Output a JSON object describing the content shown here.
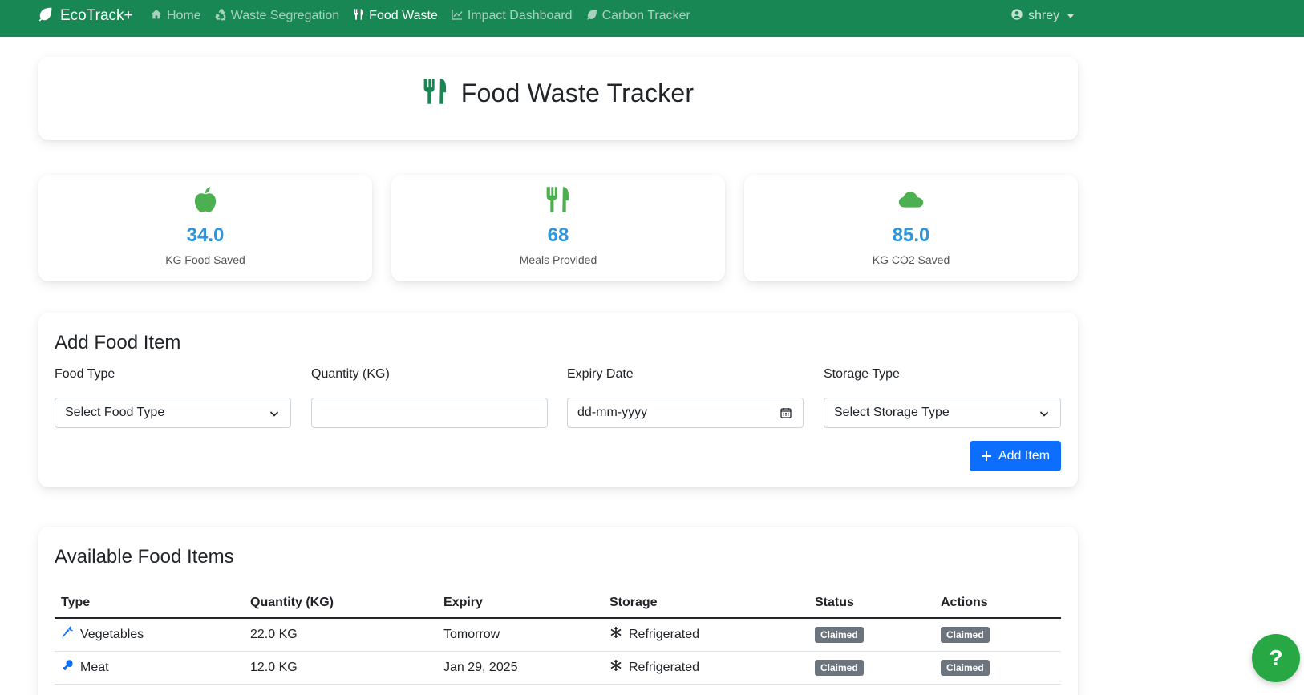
{
  "nav": {
    "brand": "EcoTrack+",
    "links": [
      {
        "label": "Home",
        "icon": "home-icon"
      },
      {
        "label": "Waste Segregation",
        "icon": "recycle-icon"
      },
      {
        "label": "Food Waste",
        "icon": "utensils-icon",
        "active": true
      },
      {
        "label": "Impact Dashboard",
        "icon": "line-chart-icon"
      },
      {
        "label": "Carbon Tracker",
        "icon": "leaf-icon"
      }
    ],
    "user": "shrey"
  },
  "header": {
    "title": "Food Waste Tracker"
  },
  "stats": [
    {
      "value": "34.0",
      "label": "KG Food Saved",
      "icon": "apple-icon"
    },
    {
      "value": "68",
      "label": "Meals Provided",
      "icon": "utensils-icon"
    },
    {
      "value": "85.0",
      "label": "KG CO2 Saved",
      "icon": "cloud-icon"
    }
  ],
  "add_form": {
    "title": "Add Food Item",
    "food_type": {
      "label": "Food Type",
      "value": "Select Food Type"
    },
    "quantity": {
      "label": "Quantity (KG)",
      "value": ""
    },
    "expiry": {
      "label": "Expiry Date",
      "value": "dd-mm-yyyy"
    },
    "storage": {
      "label": "Storage Type",
      "value": "Select Storage Type"
    },
    "submit_label": "Add Item"
  },
  "items": {
    "title": "Available Food Items",
    "columns": [
      "Type",
      "Quantity (KG)",
      "Expiry",
      "Storage",
      "Status",
      "Actions"
    ],
    "rows": [
      {
        "type": "Vegetables",
        "type_icon": "carrot-icon",
        "quantity": "22.0 KG",
        "expiry": "Tomorrow",
        "storage": "Refrigerated",
        "storage_icon": "snowflake-icon",
        "status": "Claimed",
        "action": "Claimed"
      },
      {
        "type": "Meat",
        "type_icon": "drumstick-icon",
        "quantity": "12.0 KG",
        "expiry": "Jan 29, 2025",
        "storage": "Refrigerated",
        "storage_icon": "snowflake-icon",
        "status": "Claimed",
        "action": "Claimed"
      }
    ]
  },
  "help": {
    "label": "?"
  },
  "colors": {
    "navbar": "#198754",
    "accent_green": "#28a745",
    "stat_value": "#2f95dc",
    "primary": "#0d6efd",
    "badge": "#6c757d"
  }
}
